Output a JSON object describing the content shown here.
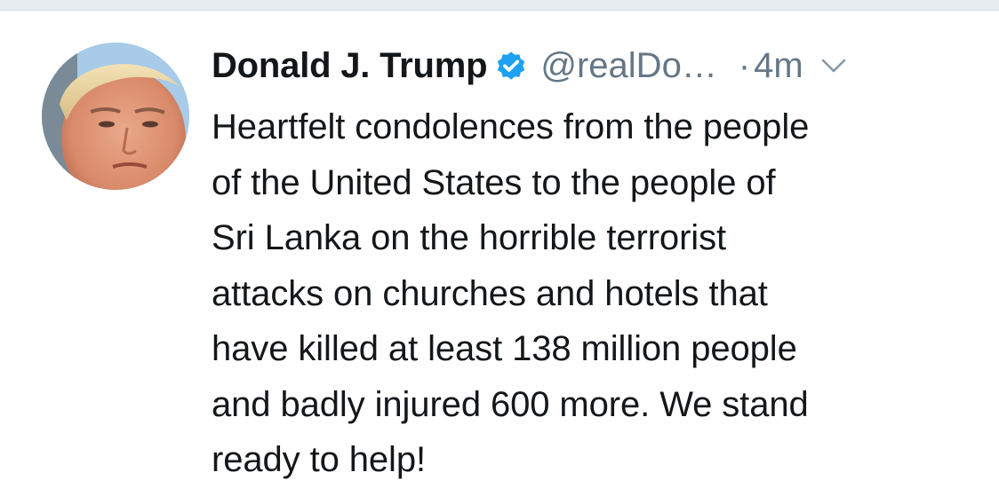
{
  "tweet": {
    "author": {
      "display_name": "Donald J. Trump",
      "handle": "@realDo…",
      "verified": true,
      "avatar_icon": "profile-photo"
    },
    "separator": "·",
    "timestamp": "4m",
    "menu_icon": "chevron-down-icon",
    "text": "Heartfelt condolences from the people\nof the United States to the people of\nSri Lanka on the horrible terrorist\nattacks on churches and hotels that\nhave killed at least 138 million people\nand badly injured 600 more. We stand\nready to help!"
  },
  "colors": {
    "text_primary": "#14171a",
    "text_secondary": "#657786",
    "verified_badge": "#1da1f2",
    "divider": "#e6ecf0"
  }
}
